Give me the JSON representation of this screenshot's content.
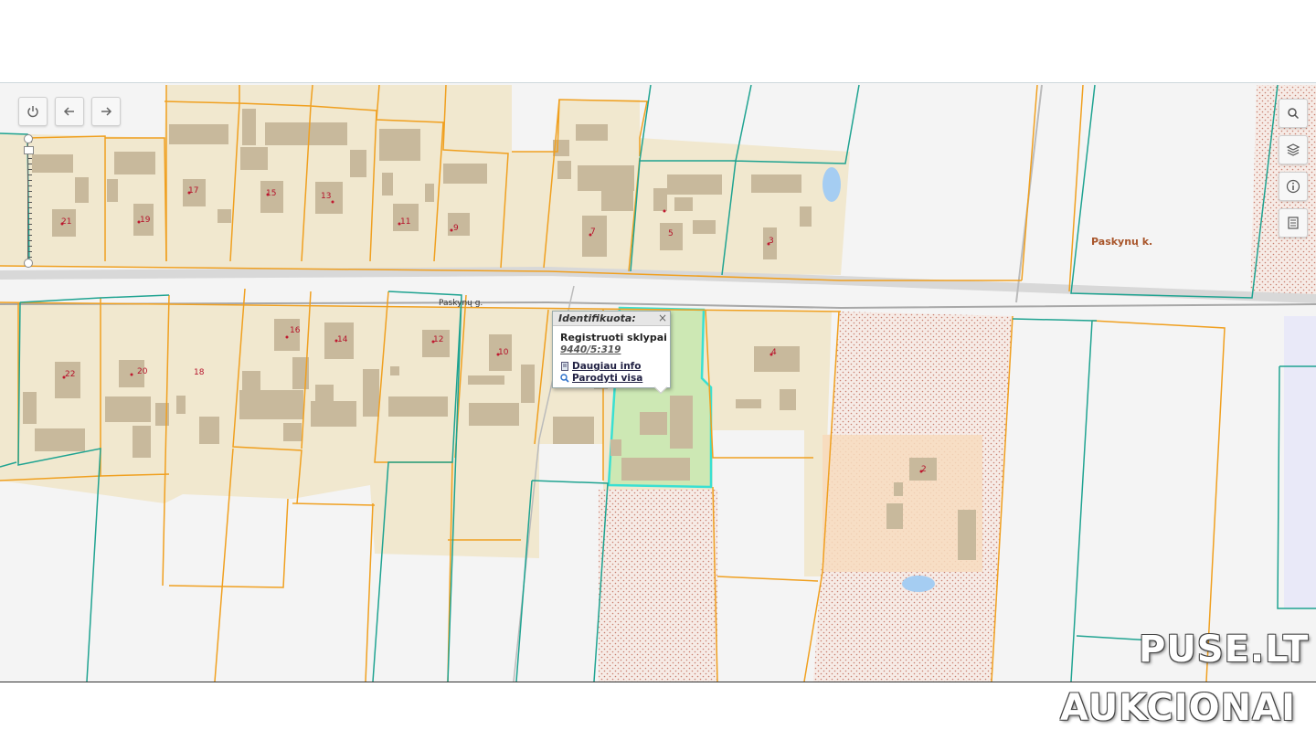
{
  "map": {
    "street_label": "Paskynų g.",
    "village_label": "Paskynų k.",
    "house_numbers_north": [
      "21",
      "19",
      "17",
      "15",
      "13",
      "11",
      "9",
      "7",
      "5",
      "3"
    ],
    "house_numbers_south": [
      "22",
      "20",
      "18",
      "16",
      "14",
      "12",
      "10",
      "4",
      "2"
    ],
    "parcel_fill_color": "#f1e8cf",
    "parcel_border_color": "#f0a020",
    "cadastre_border_color": "#1fa391",
    "selected_parcel_color": "#7fe5cf",
    "building_color": "#c8b99c"
  },
  "controls": {
    "power_icon": "power-icon",
    "back_icon": "arrow-left-icon",
    "forward_icon": "arrow-right-icon",
    "search_icon": "search-icon",
    "layers_icon": "layers-icon",
    "info_icon": "info-icon",
    "legend_icon": "document-icon"
  },
  "popup": {
    "header": "Identifikuota:",
    "close": "×",
    "title": "Registruoti sklypai",
    "parcel_id": "9440/5:319",
    "more_info": "Daugiau info",
    "show_all": "Parodyti visa"
  },
  "watermark": {
    "line1": "PUSE.LT",
    "line2": "AUKCIONAI"
  }
}
